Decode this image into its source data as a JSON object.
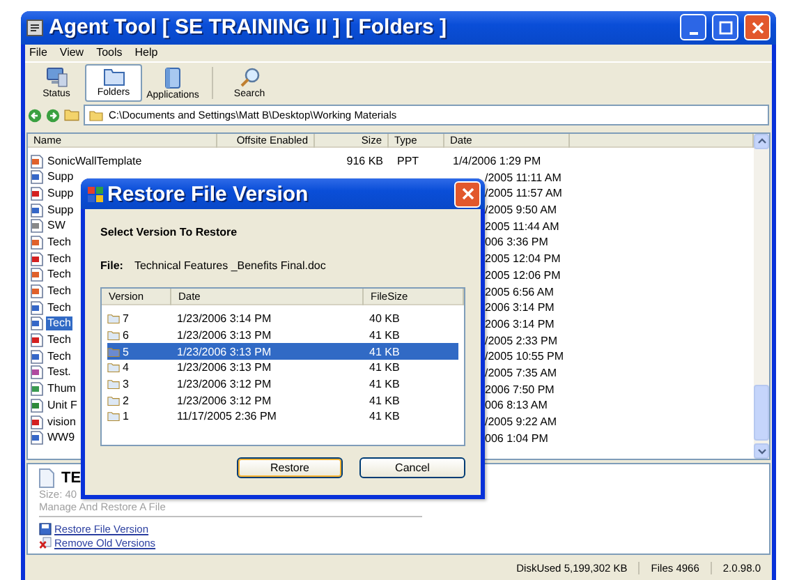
{
  "window": {
    "title": "Agent Tool [ SE TRAINING II ]  [ Folders ]"
  },
  "menu": [
    "File",
    "View",
    "Tools",
    "Help"
  ],
  "toolbar": [
    {
      "label": "Status",
      "kind": "status",
      "selected": false
    },
    {
      "label": "Folders",
      "kind": "folders",
      "selected": true
    },
    {
      "label": "Applications",
      "kind": "applications",
      "selected": false
    },
    {
      "label": "Search",
      "kind": "search",
      "selected": false
    }
  ],
  "address": {
    "value": "C:\\Documents and Settings\\Matt B\\Desktop\\Working Materials"
  },
  "file_list": {
    "columns": [
      "Name",
      "Offsite Enabled",
      "Size",
      "Type",
      "Date"
    ],
    "rows": [
      {
        "kind": "ppt",
        "name": "SonicWallTemplate",
        "size": "916 KB",
        "type": "PPT",
        "date": "1/4/2006 1:29 PM",
        "selected": false
      },
      {
        "kind": "doc",
        "name": "Supp",
        "date": "/2005 11:11 AM",
        "selected": false
      },
      {
        "kind": "pdf",
        "name": "Supp",
        "date": "/2005 11:57 AM",
        "selected": false
      },
      {
        "kind": "doc",
        "name": "Supp",
        "date": "/2005 9:50 AM",
        "selected": false
      },
      {
        "kind": "txt",
        "name": "SW",
        "date": "2005 11:44 AM",
        "selected": false
      },
      {
        "kind": "ppt",
        "name": "Tech",
        "date": "006 3:36 PM",
        "selected": false
      },
      {
        "kind": "pdf",
        "name": "Tech",
        "date": "2005 12:04 PM",
        "selected": false
      },
      {
        "kind": "ppt",
        "name": "Tech",
        "date": "2005 12:06 PM",
        "selected": false
      },
      {
        "kind": "ppt",
        "name": "Tech",
        "date": "2005 6:56 AM",
        "selected": false
      },
      {
        "kind": "doc",
        "name": "Tech",
        "date": "2006 3:14 PM",
        "selected": false
      },
      {
        "kind": "doc",
        "name": "Tech",
        "date": "2006 3:14 PM",
        "selected": true
      },
      {
        "kind": "pdf",
        "name": "Tech",
        "date": "/2005 2:33 PM",
        "selected": false
      },
      {
        "kind": "doc",
        "name": "Tech",
        "date": "/2005 10:55 PM",
        "selected": false
      },
      {
        "kind": "img",
        "name": "Test.",
        "date": "/2005 7:35 AM",
        "selected": false
      },
      {
        "kind": "thumb",
        "name": "Thum",
        "date": "2006 7:50 PM",
        "selected": false
      },
      {
        "kind": "xls",
        "name": "Unit F",
        "date": "006 8:13 AM",
        "selected": false
      },
      {
        "kind": "pdf",
        "name": "vision",
        "date": "/2005 9:22 AM",
        "selected": false
      },
      {
        "kind": "doc",
        "name": "WW9",
        "date": "006 1:04 PM",
        "selected": false
      }
    ]
  },
  "details": {
    "title": "TE",
    "size": "Size: 40",
    "subtitle": "Manage And Restore A File",
    "links": [
      {
        "kind": "restore",
        "label": "Restore File Version"
      },
      {
        "kind": "remove",
        "label": "Remove Old Versions"
      }
    ]
  },
  "status_bar": [
    "DiskUsed 5,199,302 KB",
    "Files 4966",
    "2.0.98.0"
  ],
  "dialog": {
    "title": "Restore File Version",
    "heading": "Select Version To Restore",
    "file_label": "File:",
    "file_name": "Technical Features _Benefits Final.doc",
    "columns": [
      "Version",
      "Date",
      "FileSize"
    ],
    "rows": [
      {
        "version": "7",
        "date": "1/23/2006 3:14 PM",
        "size": "40 KB",
        "selected": false
      },
      {
        "version": "6",
        "date": "1/23/2006 3:13 PM",
        "size": "41 KB",
        "selected": false
      },
      {
        "version": "5",
        "date": "1/23/2006 3:13 PM",
        "size": "41 KB",
        "selected": true
      },
      {
        "version": "4",
        "date": "1/23/2006 3:13 PM",
        "size": "41 KB",
        "selected": false
      },
      {
        "version": "3",
        "date": "1/23/2006 3:12 PM",
        "size": "41 KB",
        "selected": false
      },
      {
        "version": "2",
        "date": "1/23/2006 3:12 PM",
        "size": "41 KB",
        "selected": false
      },
      {
        "version": "1",
        "date": "11/17/2005 2:36 PM",
        "size": "41 KB",
        "selected": false
      }
    ],
    "buttons": [
      {
        "label": "Restore",
        "default": true
      },
      {
        "label": "Cancel",
        "default": false
      }
    ]
  }
}
